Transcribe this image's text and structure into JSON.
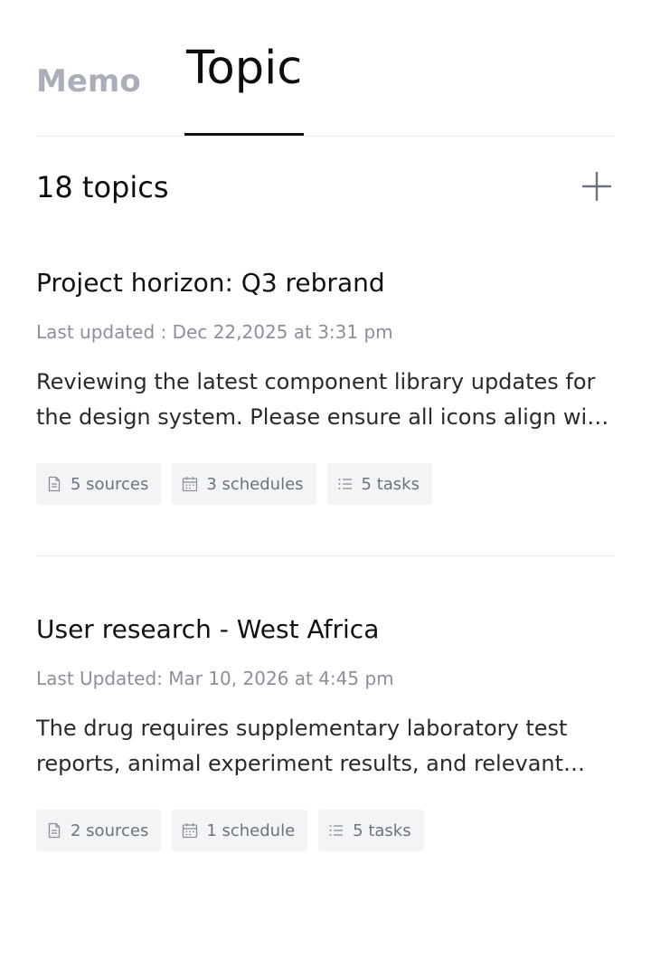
{
  "tabs": {
    "memo": "Memo",
    "topic": "Topic",
    "active": "Topic"
  },
  "topics_header": {
    "count": "18 topics",
    "add_icon": "plus-icon"
  },
  "topics": [
    {
      "title": "Project horizon: Q3 rebrand",
      "updated": "Last updated : Dec 22,2025 at 3:31 pm",
      "description": "Reviewing the latest component library updates for the design system. Please ensure all icons align with the new grid guidelines.",
      "chips": {
        "sources": "5 sources",
        "schedules": "3 schedules",
        "tasks": "5 tasks"
      }
    },
    {
      "title": "User research - West Africa",
      "updated": "Last Updated: Mar 10, 2026 at 4:45 pm",
      "description": "The drug requires supplementary laboratory test reports, animal experiment results, and relevant ethics approval documents.",
      "chips": {
        "sources": "2 sources",
        "schedules": "1 schedule",
        "tasks": "5 tasks"
      }
    }
  ],
  "colors": {
    "text_primary": "#111111",
    "text_muted": "#8a8f99",
    "inactive_tab": "#a9aeb8",
    "chip_background": "#f3f4f6",
    "divider": "#ececec"
  }
}
